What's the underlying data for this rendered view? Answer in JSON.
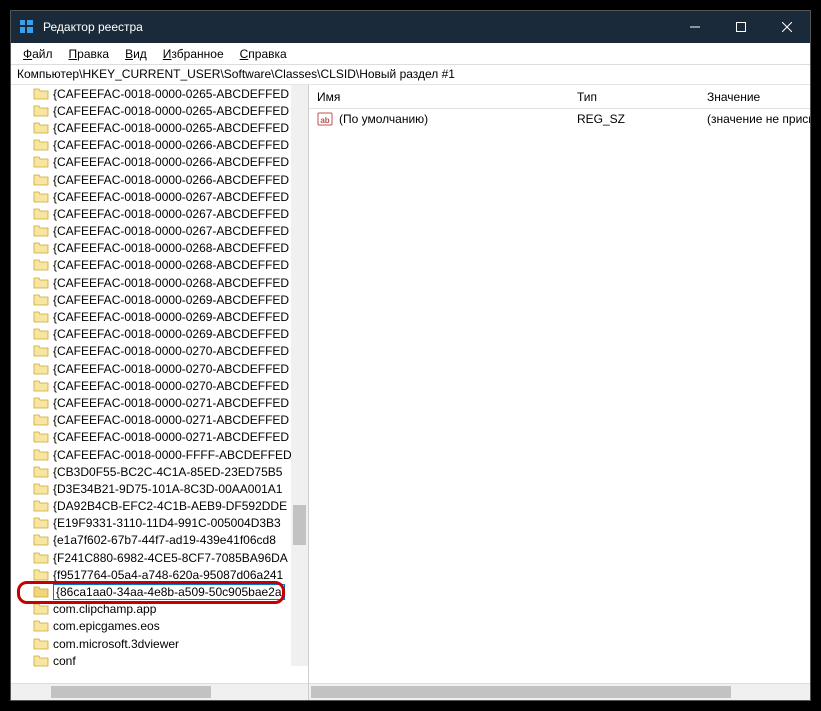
{
  "window": {
    "title": "Редактор реестра"
  },
  "menu": {
    "file": "Файл",
    "edit": "Правка",
    "view": "Вид",
    "favorites": "Избранное",
    "help": "Справка"
  },
  "address": "Компьютер\\HKEY_CURRENT_USER\\Software\\Classes\\CLSID\\Новый раздел #1",
  "tree": [
    "{CAFEEFAC-0018-0000-0265-ABCDEFFED",
    "{CAFEEFAC-0018-0000-0265-ABCDEFFED",
    "{CAFEEFAC-0018-0000-0265-ABCDEFFED",
    "{CAFEEFAC-0018-0000-0266-ABCDEFFED",
    "{CAFEEFAC-0018-0000-0266-ABCDEFFED",
    "{CAFEEFAC-0018-0000-0266-ABCDEFFED",
    "{CAFEEFAC-0018-0000-0267-ABCDEFFED",
    "{CAFEEFAC-0018-0000-0267-ABCDEFFED",
    "{CAFEEFAC-0018-0000-0267-ABCDEFFED",
    "{CAFEEFAC-0018-0000-0268-ABCDEFFED",
    "{CAFEEFAC-0018-0000-0268-ABCDEFFED",
    "{CAFEEFAC-0018-0000-0268-ABCDEFFED",
    "{CAFEEFAC-0018-0000-0269-ABCDEFFED",
    "{CAFEEFAC-0018-0000-0269-ABCDEFFED",
    "{CAFEEFAC-0018-0000-0269-ABCDEFFED",
    "{CAFEEFAC-0018-0000-0270-ABCDEFFED",
    "{CAFEEFAC-0018-0000-0270-ABCDEFFED",
    "{CAFEEFAC-0018-0000-0270-ABCDEFFED",
    "{CAFEEFAC-0018-0000-0271-ABCDEFFED",
    "{CAFEEFAC-0018-0000-0271-ABCDEFFED",
    "{CAFEEFAC-0018-0000-0271-ABCDEFFED",
    "{CAFEEFAC-0018-0000-FFFF-ABCDEFFED",
    "{CB3D0F55-BC2C-4C1A-85ED-23ED75B5",
    "{D3E34B21-9D75-101A-8C3D-00AA001A1",
    "{DA92B4CB-EFC2-4C1B-AEB9-DF592DDE",
    "{E19F9331-3110-11D4-991C-005004D3B3",
    "{e1a7f602-67b7-44f7-ad19-439e41f06cd8",
    "{F241C880-6982-4CE5-8CF7-7085BA96DA",
    "{f9517764-05a4-a748-620a-95087d06a241",
    "{86ca1aa0-34aa-4e8b-a509-50c905bae2a",
    "com.clipchamp.app",
    "com.epicgames.eos",
    "com.microsoft.3dviewer",
    "conf"
  ],
  "editing_index": 29,
  "values": {
    "headers": {
      "name": "Имя",
      "type": "Тип",
      "value": "Значение"
    },
    "rows": [
      {
        "name": "(По умолчанию)",
        "type": "REG_SZ",
        "value": "(значение не присво"
      }
    ]
  }
}
